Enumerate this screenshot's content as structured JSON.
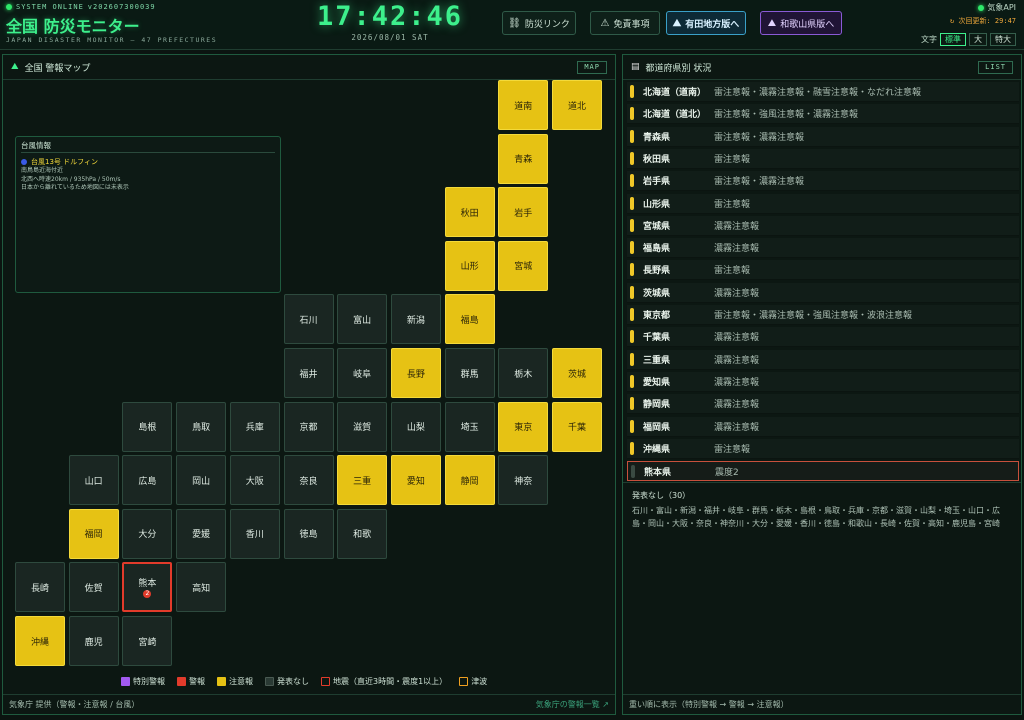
{
  "header": {
    "system_status": "SYSTEM ONLINE",
    "version": "v20260730003​9",
    "title": "全国 防災モニター",
    "subtitle": "JAPAN DISASTER MONITOR — 47 PREFECTURES",
    "clock": "17:42:46",
    "date": "2026/08/01 SAT",
    "buttons": {
      "disaster_link": "防災リンク",
      "disclaimer": "免責事項",
      "arita": "有田地方版へ",
      "wakayama": "和歌山県版へ"
    },
    "api_status": "気象API",
    "next_update_label": "次回更新:",
    "next_update_value": "29:47",
    "font_label": "文字",
    "font_sizes": [
      "標準",
      "大",
      "特大"
    ]
  },
  "colors": {
    "accent": "#3df08c",
    "advisory": "#e6c214",
    "warning": "#e23b2b",
    "special_warning": "#a25af0",
    "none": "#2a3a34",
    "tsunami": "#f0a020"
  },
  "map_panel": {
    "title": "全国 警報マップ",
    "tag": "MAP",
    "typhoon": {
      "box_title": "台風情報",
      "name": "台風13号 ドルフィン",
      "lines": [
        "南鳥島近海付近",
        "北西へ時速20km / 935hPa / 50m/s",
        "日本から離れているため地図には未表示"
      ]
    },
    "tiles": [
      {
        "name": "道南",
        "status": "advisory"
      },
      {
        "name": "道北",
        "status": "advisory"
      },
      {
        "name": "青森",
        "status": "advisory"
      },
      {
        "name": "秋田",
        "status": "advisory"
      },
      {
        "name": "岩手",
        "status": "advisory"
      },
      {
        "name": "山形",
        "status": "advisory"
      },
      {
        "name": "宮城",
        "status": "advisory"
      },
      {
        "name": "石川",
        "status": "none"
      },
      {
        "name": "富山",
        "status": "none"
      },
      {
        "name": "新潟",
        "status": "none"
      },
      {
        "name": "福島",
        "status": "advisory"
      },
      {
        "name": "福井",
        "status": "none"
      },
      {
        "name": "岐阜",
        "status": "none"
      },
      {
        "name": "長野",
        "status": "advisory"
      },
      {
        "name": "群馬",
        "status": "none"
      },
      {
        "name": "栃木",
        "status": "none"
      },
      {
        "name": "茨城",
        "status": "advisory"
      },
      {
        "name": "島根",
        "status": "none"
      },
      {
        "name": "鳥取",
        "status": "none"
      },
      {
        "name": "兵庫",
        "status": "none"
      },
      {
        "name": "京都",
        "status": "none"
      },
      {
        "name": "滋賀",
        "status": "none"
      },
      {
        "name": "山梨",
        "status": "none"
      },
      {
        "name": "埼玉",
        "status": "none"
      },
      {
        "name": "東京",
        "status": "advisory"
      },
      {
        "name": "千葉",
        "status": "advisory"
      },
      {
        "name": "山口",
        "status": "none"
      },
      {
        "name": "広島",
        "status": "none"
      },
      {
        "name": "岡山",
        "status": "none"
      },
      {
        "name": "大阪",
        "status": "none"
      },
      {
        "name": "奈良",
        "status": "none"
      },
      {
        "name": "三重",
        "status": "advisory"
      },
      {
        "name": "愛知",
        "status": "advisory"
      },
      {
        "name": "静岡",
        "status": "advisory"
      },
      {
        "name": "神奈",
        "status": "none"
      },
      {
        "name": "福岡",
        "status": "advisory"
      },
      {
        "name": "大分",
        "status": "none"
      },
      {
        "name": "愛媛",
        "status": "none"
      },
      {
        "name": "香川",
        "status": "none"
      },
      {
        "name": "徳島",
        "status": "none"
      },
      {
        "name": "和歌",
        "status": "none"
      },
      {
        "name": "長崎",
        "status": "none"
      },
      {
        "name": "佐賀",
        "status": "none"
      },
      {
        "name": "熊本",
        "status": "quake",
        "badge": "2"
      },
      {
        "name": "高知",
        "status": "none"
      },
      {
        "name": "沖縄",
        "status": "advisory"
      },
      {
        "name": "鹿児",
        "status": "none"
      },
      {
        "name": "宮崎",
        "status": "none"
      }
    ],
    "legend": [
      {
        "label": "特別警報",
        "color": "#a25af0",
        "kind": "fill"
      },
      {
        "label": "警報",
        "color": "#e23b2b",
        "kind": "fill"
      },
      {
        "label": "注意報",
        "color": "#e6c214",
        "kind": "fill"
      },
      {
        "label": "発表なし",
        "color": "#2a3a34",
        "kind": "fill"
      },
      {
        "label": "地震（直近3時間・震度1以上）",
        "color": "#e23b2b",
        "kind": "outline"
      },
      {
        "label": "津波",
        "color": "#f0a020",
        "kind": "outline"
      }
    ],
    "footer_left": "気象庁 提供（警報・注意報 / 台風）",
    "footer_right": "気象庁の警報一覧 ↗"
  },
  "list_panel": {
    "title": "都道府県別 状況",
    "tag": "LIST",
    "rows": [
      {
        "pref": "北海道（道南）",
        "info": "雷注意報・濃霧注意報・融雪注意報・なだれ注意報"
      },
      {
        "pref": "北海道（道北）",
        "info": "雷注意報・強風注意報・濃霧注意報"
      },
      {
        "pref": "青森県",
        "info": "雷注意報・濃霧注意報"
      },
      {
        "pref": "秋田県",
        "info": "雷注意報"
      },
      {
        "pref": "岩手県",
        "info": "雷注意報・濃霧注意報"
      },
      {
        "pref": "山形県",
        "info": "雷注意報"
      },
      {
        "pref": "宮城県",
        "info": "濃霧注意報"
      },
      {
        "pref": "福島県",
        "info": "濃霧注意報"
      },
      {
        "pref": "長野県",
        "info": "雷注意報"
      },
      {
        "pref": "茨城県",
        "info": "濃霧注意報"
      },
      {
        "pref": "東京都",
        "info": "雷注意報・濃霧注意報・強風注意報・波浪注意報"
      },
      {
        "pref": "千葉県",
        "info": "濃霧注意報"
      },
      {
        "pref": "三重県",
        "info": "濃霧注意報"
      },
      {
        "pref": "愛知県",
        "info": "濃霧注意報"
      },
      {
        "pref": "静岡県",
        "info": "濃霧注意報"
      },
      {
        "pref": "福岡県",
        "info": "濃霧注意報"
      },
      {
        "pref": "沖縄県",
        "info": "雷注意報"
      },
      {
        "pref": "熊本県",
        "info": "震度2",
        "quake": true
      }
    ],
    "none_title": "発表なし（30）",
    "none_list": "石川・富山・新潟・福井・岐阜・群馬・栃木・島根・鳥取・兵庫・京都・滋賀・山梨・埼玉・山口・広島・岡山・大阪・奈良・神奈川・大分・愛媛・香川・徳島・和歌山・長崎・佐賀・高知・鹿児島・宮崎",
    "footer": "重い順に表示（特別警報 → 警報 → 注意報）"
  }
}
